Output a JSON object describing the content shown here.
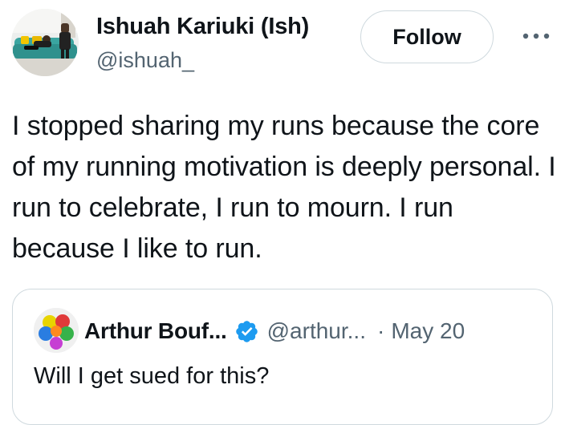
{
  "author": {
    "name": "Ishuah Kariuki (Ish)",
    "handle": "@ishuah_"
  },
  "actions": {
    "follow_label": "Follow",
    "more_icon": "more-horizontal-icon"
  },
  "tweet": {
    "text": "I stopped sharing my runs because the core of my running motivation is deeply personal. I run to celebrate, I run to mourn. I run because I like to run."
  },
  "quoted_tweet": {
    "name": "Arthur Bouf...",
    "verified_icon": "verified-badge-icon",
    "handle": "@arthur...",
    "separator": "·",
    "date": "May 20",
    "text": "Will I get sued for this?"
  },
  "colors": {
    "primary_text": "#0f1419",
    "secondary_text": "#536471",
    "border": "#cfd9de",
    "verified_blue": "#1d9bf0"
  }
}
